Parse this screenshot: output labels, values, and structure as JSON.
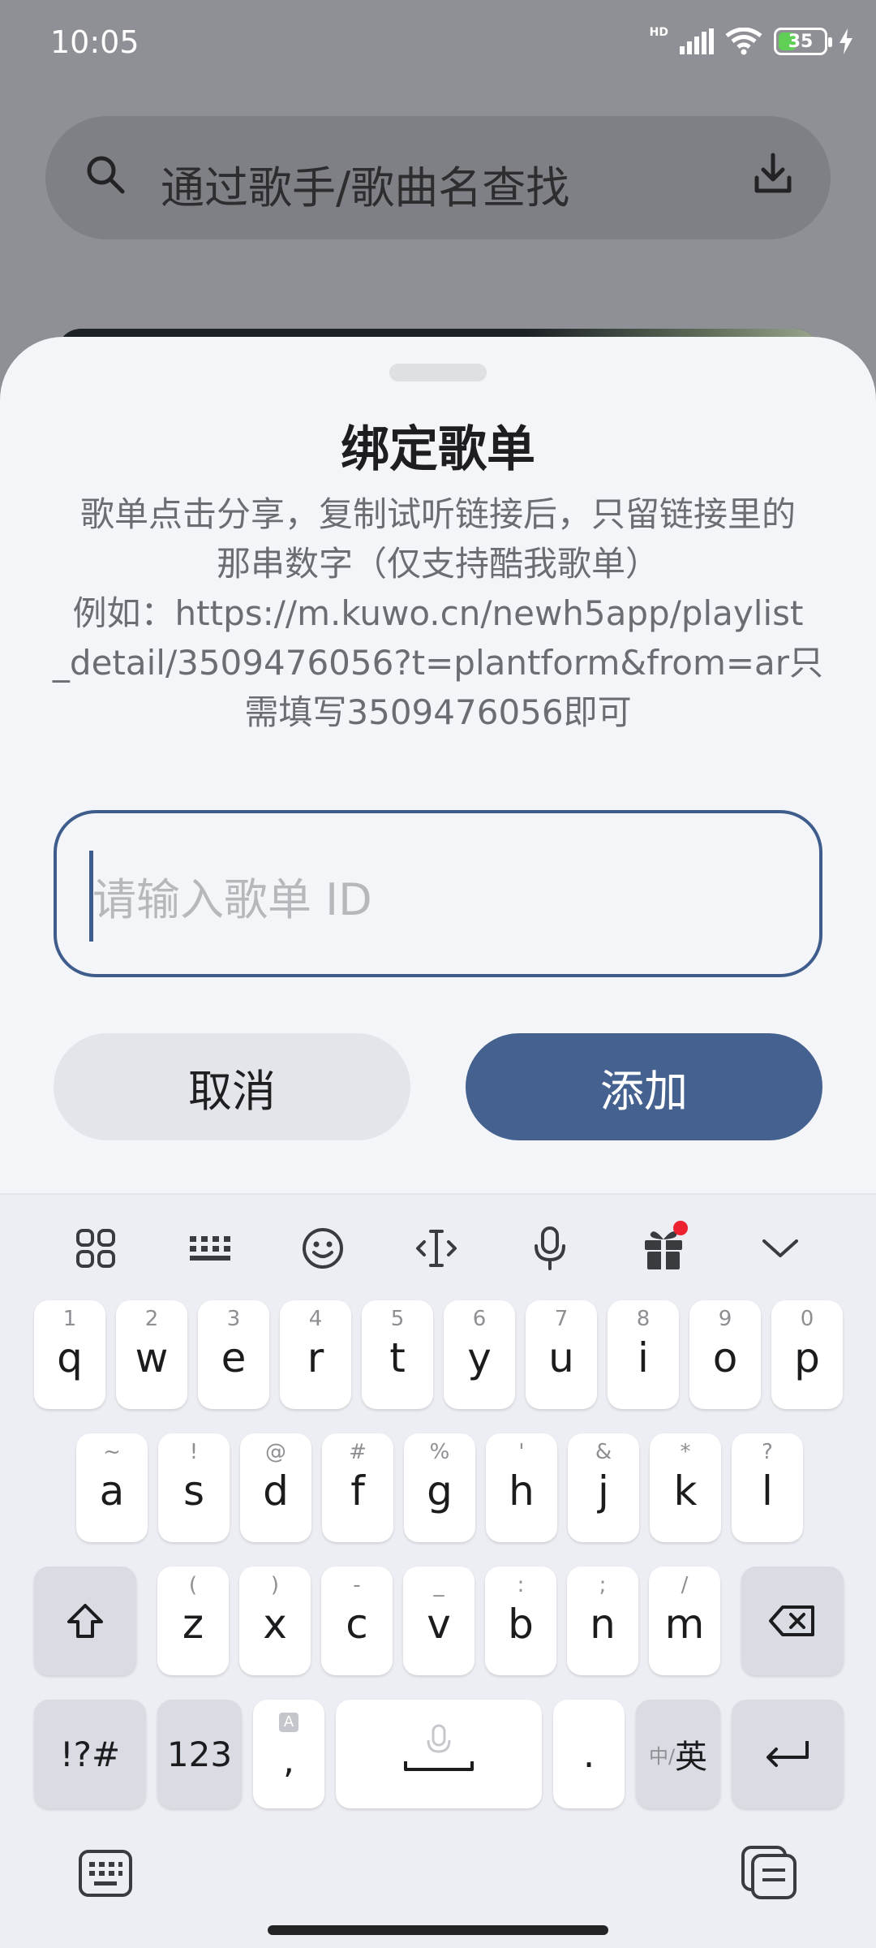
{
  "status_bar": {
    "time": "10:05",
    "network": "HD",
    "battery": "35"
  },
  "search": {
    "placeholder": "通过歌手/歌曲名查找"
  },
  "dialog": {
    "title": "绑定歌单",
    "description_lines": [
      "歌单点击分享，复制试听链接后，只留链接里的",
      "那串数字（仅支持酷我歌单）",
      "例如：https://m.kuwo.cn/newh5app/playlist",
      "_detail/3509476056?t=plantform&from=ar只",
      "需填写3509476056即可"
    ],
    "input_placeholder": "请输入歌单 ID",
    "cancel_label": "取消",
    "add_label": "添加"
  },
  "keyboard": {
    "toolbar_icons": [
      "apps-grid-icon",
      "keyboard-layout-icon",
      "emoji-icon",
      "cursor-move-icon",
      "microphone-icon",
      "gift-icon",
      "collapse-chevron-icon"
    ],
    "row1": [
      {
        "k": "q",
        "h": "1"
      },
      {
        "k": "w",
        "h": "2"
      },
      {
        "k": "e",
        "h": "3"
      },
      {
        "k": "r",
        "h": "4"
      },
      {
        "k": "t",
        "h": "5"
      },
      {
        "k": "y",
        "h": "6"
      },
      {
        "k": "u",
        "h": "7"
      },
      {
        "k": "i",
        "h": "8"
      },
      {
        "k": "o",
        "h": "9"
      },
      {
        "k": "p",
        "h": "0"
      }
    ],
    "row2": [
      {
        "k": "a",
        "h": "~"
      },
      {
        "k": "s",
        "h": "!"
      },
      {
        "k": "d",
        "h": "@"
      },
      {
        "k": "f",
        "h": "#"
      },
      {
        "k": "g",
        "h": "%"
      },
      {
        "k": "h",
        "h": "'"
      },
      {
        "k": "j",
        "h": "&"
      },
      {
        "k": "k",
        "h": "*"
      },
      {
        "k": "l",
        "h": "?"
      }
    ],
    "row3": [
      {
        "k": "z",
        "h": "("
      },
      {
        "k": "x",
        "h": ")"
      },
      {
        "k": "c",
        "h": "-"
      },
      {
        "k": "v",
        "h": "_"
      },
      {
        "k": "b",
        "h": ":"
      },
      {
        "k": "n",
        "h": ";"
      },
      {
        "k": "m",
        "h": "/"
      }
    ],
    "symbols_label": "!?#",
    "numbers_label": "123",
    "comma_label": ",",
    "comma_hint": "A",
    "period_label": ".",
    "lang_small": "中/",
    "lang_big": "英",
    "accent_color": "#45618f"
  }
}
